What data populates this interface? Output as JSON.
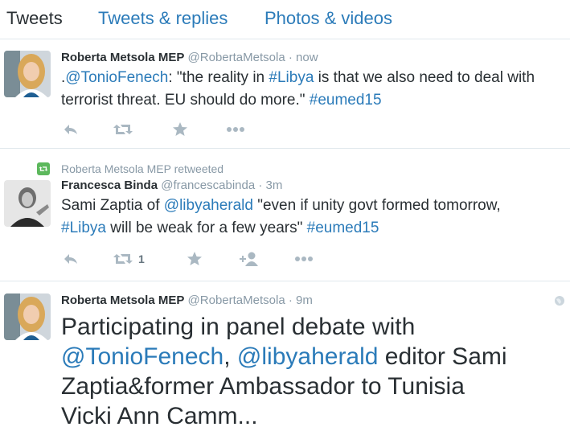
{
  "tabs": [
    {
      "label": "Tweets"
    },
    {
      "label": "Tweets & replies"
    },
    {
      "label": "Photos & videos"
    }
  ],
  "tweets": [
    {
      "name": "Roberta Metsola MEP",
      "handle": "@RobertaMetsola",
      "sep": "·",
      "time": "now",
      "segments": [
        ".",
        "@TonioFenech",
        ": \"the reality in ",
        "#Libya",
        " is that we also need to deal with",
        "terrorist threat. EU should do more.\" ",
        "#eumed15"
      ]
    },
    {
      "retweet_context": "Roberta Metsola MEP retweeted",
      "name": "Francesca Binda",
      "handle": "@francescabinda",
      "sep": "·",
      "time": "3m",
      "segments": [
        "Sami Zaptia of ",
        "@libyaherald",
        " \"even if unity govt formed tomorrow,",
        "#Libya",
        " will be weak for a few years\" ",
        "#eumed15"
      ],
      "retweet_count": "1"
    },
    {
      "name": "Roberta Metsola MEP",
      "handle": "@RobertaMetsola",
      "sep": "·",
      "time": "9m",
      "segments": [
        "Participating in panel debate with",
        "@TonioFenech",
        ", ",
        "@libyaherald",
        " editor Sami",
        "Zaptia&former Ambassador to Tunisia",
        "Vicki Ann Camm..."
      ]
    }
  ],
  "colors": {
    "link": "#2b7bb9",
    "muted": "#8899a6",
    "icon": "#aab8c2",
    "retweet": "#5cb85c"
  }
}
